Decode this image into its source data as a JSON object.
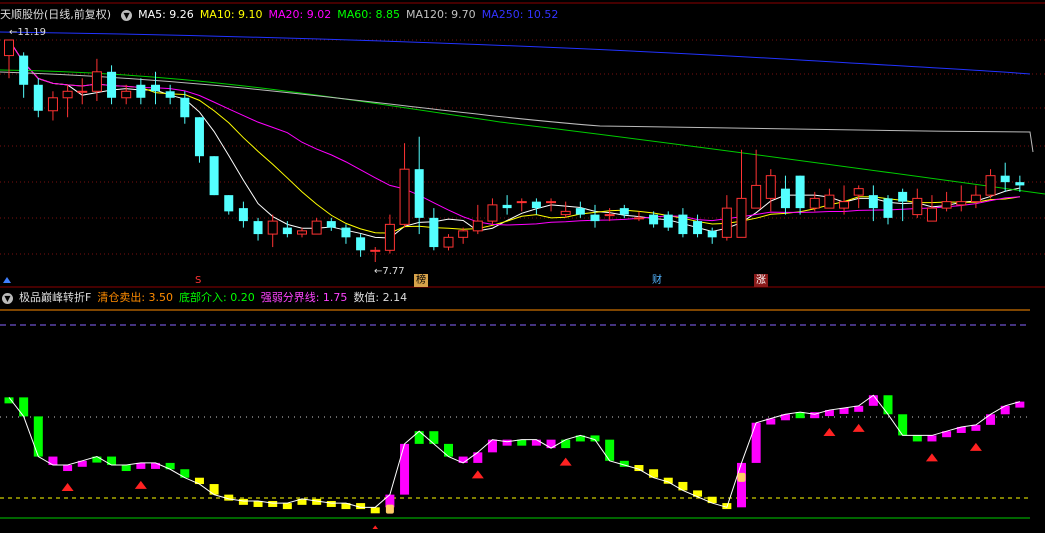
{
  "main_chart": {
    "stock_name": "天顺股份",
    "period": "(日线,前复权)",
    "ma": [
      {
        "label": "MA5: 9.26",
        "color": "#ffffff"
      },
      {
        "label": "MA10: 9.10",
        "color": "#ffff00"
      },
      {
        "label": "MA20: 9.02",
        "color": "#ff00ff"
      },
      {
        "label": "MA60: 8.85",
        "color": "#00ff00"
      },
      {
        "label": "MA120: 9.70",
        "color": "#c0c0c0"
      },
      {
        "label": "MA250: 10.52",
        "color": "#3333ff"
      }
    ],
    "high_label": "11.19",
    "low_label": "7.77",
    "markers": [
      "S",
      "榜",
      "财",
      "涨"
    ]
  },
  "indicator": {
    "name": "极品巅峰转折F",
    "params": [
      {
        "label": "清仓卖出: 3.50",
        "color": "#ff8c00"
      },
      {
        "label": "底部介入: 0.20",
        "color": "#00ff00"
      },
      {
        "label": "强弱分界线: 1.75",
        "color": "#ff44ff"
      },
      {
        "label": "数值: 2.14",
        "color": "#dddddd"
      }
    ]
  },
  "colors": {
    "up": "#ff3333",
    "down": "#54ffff",
    "bg": "#000000"
  },
  "chart_data": [
    {
      "type": "candlestick",
      "title": "天顺股份",
      "x": [
        1,
        2,
        3,
        4,
        5,
        6,
        7,
        8,
        9,
        10,
        11,
        12,
        13,
        14,
        15,
        16,
        17,
        18,
        19,
        20,
        21,
        22,
        23,
        24,
        25,
        26,
        27,
        28,
        29,
        30,
        31,
        32,
        33,
        34,
        35,
        36,
        37,
        38,
        39,
        40,
        41,
        42,
        43,
        44,
        45,
        46,
        47,
        48,
        49,
        50,
        51,
        52,
        53,
        54,
        55,
        56,
        57,
        58,
        59,
        60,
        61,
        62,
        63,
        64,
        65,
        66,
        67,
        68,
        69,
        70
      ],
      "open": [
        10.95,
        10.95,
        10.5,
        10.1,
        10.3,
        10.4,
        10.4,
        10.7,
        10.3,
        10.5,
        10.5,
        10.4,
        10.3,
        10.0,
        9.4,
        8.8,
        8.6,
        8.4,
        8.2,
        8.3,
        8.2,
        8.2,
        8.4,
        8.3,
        8.15,
        7.95,
        7.95,
        8.35,
        9.2,
        8.45,
        8.0,
        8.15,
        8.25,
        8.4,
        8.65,
        8.7,
        8.7,
        8.7,
        8.5,
        8.6,
        8.5,
        8.5,
        8.6,
        8.45,
        8.5,
        8.5,
        8.5,
        8.4,
        8.25,
        8.15,
        8.15,
        8.6,
        8.75,
        8.9,
        9.1,
        8.6,
        8.6,
        8.6,
        8.8,
        8.8,
        8.75,
        8.85,
        8.5,
        8.4,
        8.6,
        8.65,
        8.7,
        8.8,
        9.1,
        9.0
      ],
      "close": [
        11.19,
        10.5,
        10.1,
        10.3,
        10.4,
        10.4,
        10.7,
        10.3,
        10.4,
        10.3,
        10.4,
        10.3,
        10.0,
        9.4,
        8.8,
        8.55,
        8.4,
        8.2,
        8.4,
        8.2,
        8.25,
        8.4,
        8.3,
        8.15,
        7.95,
        7.95,
        8.35,
        9.2,
        8.45,
        8.0,
        8.15,
        8.25,
        8.4,
        8.65,
        8.6,
        8.7,
        8.6,
        8.7,
        8.55,
        8.5,
        8.4,
        8.5,
        8.5,
        8.45,
        8.35,
        8.3,
        8.2,
        8.2,
        8.15,
        8.6,
        8.75,
        8.95,
        9.1,
        8.6,
        8.6,
        8.75,
        8.8,
        8.7,
        8.9,
        8.6,
        8.45,
        8.7,
        8.75,
        8.6,
        8.7,
        8.7,
        8.8,
        9.1,
        9.0,
        8.95
      ],
      "high": [
        11.19,
        11.0,
        10.6,
        10.4,
        10.5,
        10.6,
        10.9,
        10.8,
        10.5,
        10.6,
        10.7,
        10.5,
        10.4,
        10.0,
        9.4,
        8.8,
        8.7,
        8.45,
        8.5,
        8.4,
        8.3,
        8.45,
        8.45,
        8.35,
        8.2,
        8.0,
        8.5,
        9.6,
        9.7,
        8.6,
        8.2,
        8.3,
        8.65,
        8.75,
        8.8,
        8.75,
        8.75,
        8.75,
        8.7,
        8.7,
        8.65,
        8.6,
        8.65,
        8.55,
        8.55,
        8.55,
        8.6,
        8.5,
        8.3,
        8.8,
        9.5,
        9.5,
        9.2,
        9.1,
        9.1,
        8.85,
        8.9,
        8.95,
        8.95,
        8.95,
        8.8,
        8.9,
        8.9,
        8.8,
        8.85,
        8.95,
        8.95,
        9.2,
        9.3,
        9.1
      ],
      "low": [
        10.6,
        10.3,
        10.0,
        9.95,
        10.0,
        10.2,
        10.25,
        10.2,
        10.2,
        10.2,
        10.2,
        10.2,
        9.9,
        9.3,
        8.8,
        8.5,
        8.3,
        8.1,
        8.0,
        8.15,
        8.15,
        8.2,
        8.25,
        8.05,
        7.85,
        7.77,
        7.9,
        8.3,
        8.2,
        7.95,
        7.95,
        8.05,
        8.2,
        8.35,
        8.5,
        8.55,
        8.5,
        8.55,
        8.45,
        8.45,
        8.3,
        8.4,
        8.45,
        8.4,
        8.3,
        8.25,
        8.15,
        8.15,
        8.05,
        8.1,
        8.5,
        8.6,
        8.55,
        8.5,
        8.5,
        8.55,
        8.6,
        8.5,
        8.6,
        8.4,
        8.35,
        8.4,
        8.45,
        8.4,
        8.55,
        8.55,
        8.6,
        8.75,
        8.85,
        8.85
      ]
    },
    {
      "type": "bar",
      "title": "极品巅峰转折F",
      "x": [
        1,
        2,
        3,
        4,
        5,
        6,
        7,
        8,
        9,
        10,
        11,
        12,
        13,
        14,
        15,
        16,
        17,
        18,
        19,
        20,
        21,
        22,
        23,
        24,
        25,
        26,
        27,
        28,
        29,
        30,
        31,
        32,
        33,
        34,
        35,
        36,
        37,
        38,
        39,
        40,
        41,
        42,
        43,
        44,
        45,
        46,
        47,
        48,
        49,
        50,
        51,
        52,
        53,
        54,
        55,
        56,
        57,
        58,
        59,
        60,
        61,
        62,
        63,
        64,
        65,
        66,
        67,
        68,
        69,
        70
      ],
      "values": [
        2.9,
        2.45,
        1.5,
        1.3,
        1.3,
        1.4,
        1.5,
        1.3,
        1.3,
        1.35,
        1.35,
        1.2,
        1.0,
        0.85,
        0.6,
        0.5,
        0.45,
        0.45,
        0.4,
        0.4,
        0.5,
        0.45,
        0.4,
        0.4,
        0.3,
        0.3,
        0.6,
        1.8,
        2.1,
        1.8,
        1.5,
        1.35,
        1.6,
        1.9,
        1.85,
        1.9,
        1.9,
        1.7,
        1.9,
        2.0,
        1.9,
        1.4,
        1.3,
        1.2,
        1.0,
        0.9,
        0.7,
        0.55,
        0.4,
        0.3,
        1.35,
        2.3,
        2.4,
        2.5,
        2.55,
        2.5,
        2.6,
        2.65,
        2.7,
        2.95,
        2.5,
        2.0,
        2.0,
        2.0,
        2.1,
        2.2,
        2.25,
        2.5,
        2.7,
        2.8
      ],
      "colors": [
        "g",
        "g",
        "g",
        "m",
        "m",
        "m",
        "g",
        "g",
        "g",
        "m",
        "m",
        "g",
        "g",
        "y",
        "y",
        "y",
        "y",
        "y",
        "y",
        "y",
        "y",
        "y",
        "y",
        "y",
        "y",
        "y",
        "m",
        "m",
        "g",
        "g",
        "g",
        "m",
        "m",
        "m",
        "m",
        "g",
        "m",
        "m",
        "g",
        "g",
        "g",
        "g",
        "g",
        "y",
        "y",
        "y",
        "y",
        "y",
        "y",
        "y",
        "m",
        "m",
        "m",
        "m",
        "g",
        "m",
        "m",
        "m",
        "m",
        "m",
        "g",
        "g",
        "g",
        "m",
        "m",
        "m",
        "m",
        "m",
        "m",
        "m"
      ],
      "lines": {
        "清仓卖出": 3.5,
        "底部介入": 0.2,
        "强弱分界线": 1.75
      }
    }
  ]
}
